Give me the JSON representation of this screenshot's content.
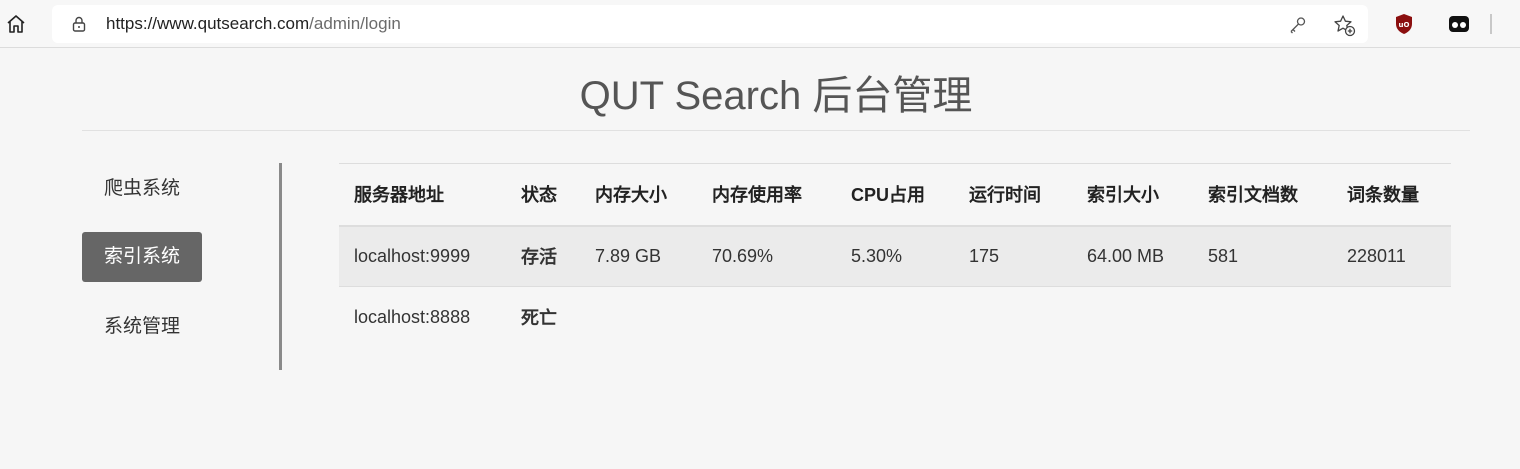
{
  "browser": {
    "url_host": "https://www.qutsearch.com",
    "url_path": "/admin/login",
    "colors": {
      "ublock": "#8b0f0f"
    }
  },
  "page": {
    "title": "QUT Search 后台管理"
  },
  "sidebar": {
    "items": [
      {
        "label": "爬虫系统",
        "active": false
      },
      {
        "label": "索引系统",
        "active": true
      },
      {
        "label": "系统管理",
        "active": false
      }
    ],
    "active_color": "#666666"
  },
  "table": {
    "headers": [
      "服务器地址",
      "状态",
      "内存大小",
      "内存使用率",
      "CPU占用",
      "运行时间",
      "索引大小",
      "索引文档数",
      "词条数量"
    ],
    "rows": [
      [
        "localhost:9999",
        "存活",
        "7.89 GB",
        "70.69%",
        "5.30%",
        "175",
        "64.00 MB",
        "581",
        "228011"
      ],
      [
        "localhost:8888",
        "死亡",
        "",
        "",
        "",
        "",
        "",
        "",
        ""
      ]
    ],
    "status_colors": {
      "alive": "#2fb944",
      "dead": "#ff0000"
    }
  }
}
